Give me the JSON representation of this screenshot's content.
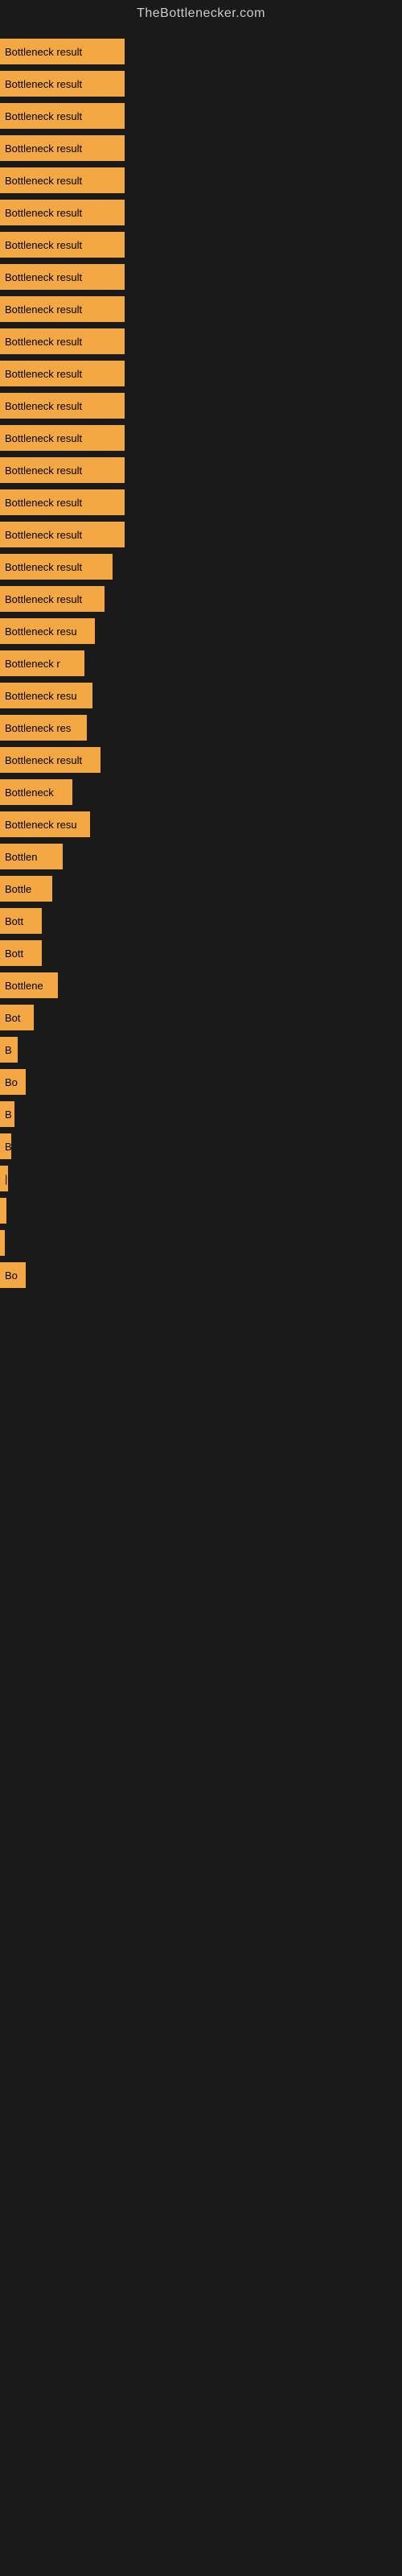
{
  "site": {
    "title": "TheBottlenecker.com"
  },
  "bars": [
    {
      "label": "Bottleneck result",
      "width": 155
    },
    {
      "label": "Bottleneck result",
      "width": 155
    },
    {
      "label": "Bottleneck result",
      "width": 155
    },
    {
      "label": "Bottleneck result",
      "width": 155
    },
    {
      "label": "Bottleneck result",
      "width": 155
    },
    {
      "label": "Bottleneck result",
      "width": 155
    },
    {
      "label": "Bottleneck result",
      "width": 155
    },
    {
      "label": "Bottleneck result",
      "width": 155
    },
    {
      "label": "Bottleneck result",
      "width": 155
    },
    {
      "label": "Bottleneck result",
      "width": 155
    },
    {
      "label": "Bottleneck result",
      "width": 155
    },
    {
      "label": "Bottleneck result",
      "width": 155
    },
    {
      "label": "Bottleneck result",
      "width": 155
    },
    {
      "label": "Bottleneck result",
      "width": 155
    },
    {
      "label": "Bottleneck result",
      "width": 155
    },
    {
      "label": "Bottleneck result",
      "width": 155
    },
    {
      "label": "Bottleneck result",
      "width": 140
    },
    {
      "label": "Bottleneck result",
      "width": 130
    },
    {
      "label": "Bottleneck resu",
      "width": 118
    },
    {
      "label": "Bottleneck r",
      "width": 105
    },
    {
      "label": "Bottleneck resu",
      "width": 115
    },
    {
      "label": "Bottleneck res",
      "width": 108
    },
    {
      "label": "Bottleneck result",
      "width": 125
    },
    {
      "label": "Bottleneck",
      "width": 90
    },
    {
      "label": "Bottleneck resu",
      "width": 112
    },
    {
      "label": "Bottlen",
      "width": 78
    },
    {
      "label": "Bottle",
      "width": 65
    },
    {
      "label": "Bott",
      "width": 52
    },
    {
      "label": "Bott",
      "width": 52
    },
    {
      "label": "Bottlene",
      "width": 72
    },
    {
      "label": "Bot",
      "width": 42
    },
    {
      "label": "B",
      "width": 22
    },
    {
      "label": "Bo",
      "width": 32
    },
    {
      "label": "B",
      "width": 18
    },
    {
      "label": "B",
      "width": 14
    },
    {
      "label": "|",
      "width": 10
    },
    {
      "label": "",
      "width": 8
    },
    {
      "label": "",
      "width": 6
    },
    {
      "label": "Bo",
      "width": 32
    }
  ]
}
